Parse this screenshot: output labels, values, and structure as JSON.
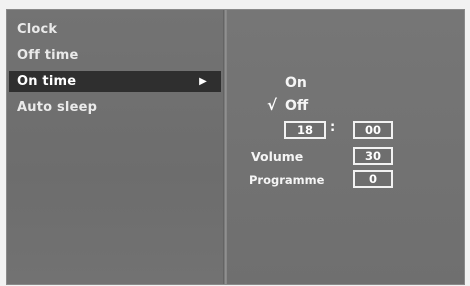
{
  "menu": {
    "items": [
      {
        "label": "Clock"
      },
      {
        "label": "Off time"
      },
      {
        "label": "On time",
        "active": true
      },
      {
        "label": "Auto sleep"
      }
    ],
    "active_arrow": "▶"
  },
  "on_time": {
    "option_on": "On",
    "option_off": "Off",
    "selected_mark": "√",
    "hour": "18",
    "separator": ":",
    "minute": "00",
    "volume_label": "Volume",
    "volume_value": "30",
    "programme_label": "Programme",
    "programme_value": "0"
  },
  "colors": {
    "panel": "#737373",
    "highlight": "#2f2f2f",
    "text": "#f5f5f5"
  }
}
